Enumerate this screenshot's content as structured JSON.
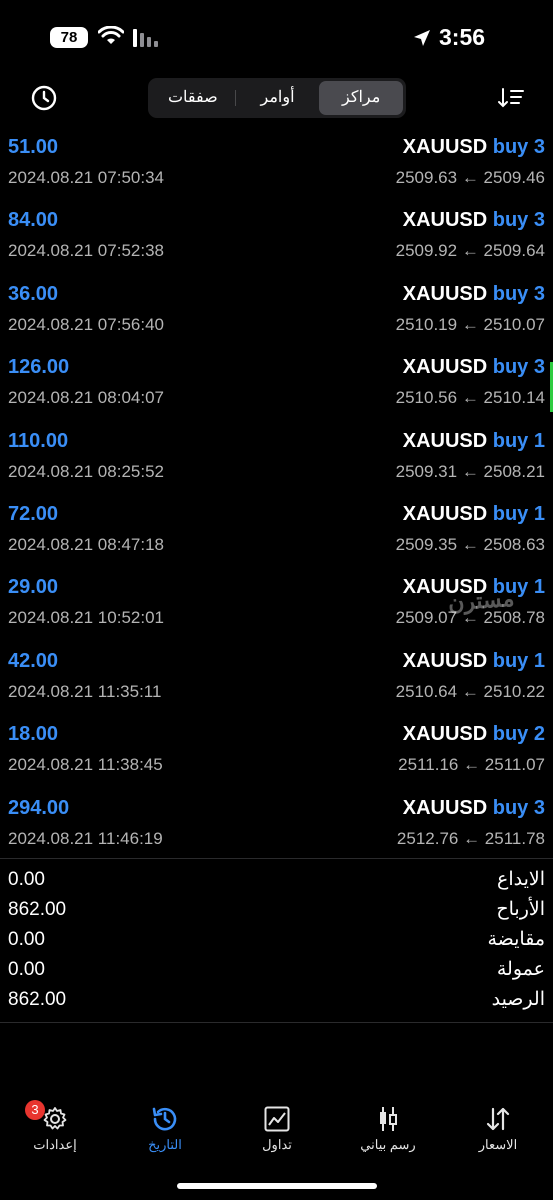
{
  "status_bar": {
    "battery": "78",
    "time": "3:56"
  },
  "header": {
    "tabs": [
      {
        "label": "مراكز",
        "active": true
      },
      {
        "label": "أوامر",
        "active": false
      },
      {
        "label": "صفقات",
        "active": false
      }
    ]
  },
  "deals": [
    {
      "symbol": "XAUUSD",
      "side": "buy 3",
      "profit": "51.00",
      "time": "2024.08.21 07:50:34",
      "prices": "2509.63 ← 2509.46"
    },
    {
      "symbol": "XAUUSD",
      "side": "buy 3",
      "profit": "84.00",
      "time": "2024.08.21 07:52:38",
      "prices": "2509.92 ← 2509.64"
    },
    {
      "symbol": "XAUUSD",
      "side": "buy 3",
      "profit": "36.00",
      "time": "2024.08.21 07:56:40",
      "prices": "2510.19 ← 2510.07"
    },
    {
      "symbol": "XAUUSD",
      "side": "buy 3",
      "profit": "126.00",
      "time": "2024.08.21 08:04:07",
      "prices": "2510.56 ← 2510.14"
    },
    {
      "symbol": "XAUUSD",
      "side": "buy 1",
      "profit": "110.00",
      "time": "2024.08.21 08:25:52",
      "prices": "2509.31 ← 2508.21"
    },
    {
      "symbol": "XAUUSD",
      "side": "buy 1",
      "profit": "72.00",
      "time": "2024.08.21 08:47:18",
      "prices": "2509.35 ← 2508.63"
    },
    {
      "symbol": "XAUUSD",
      "side": "buy 1",
      "profit": "29.00",
      "time": "2024.08.21 10:52:01",
      "prices": "2509.07 ← 2508.78"
    },
    {
      "symbol": "XAUUSD",
      "side": "buy 1",
      "profit": "42.00",
      "time": "2024.08.21 11:35:11",
      "prices": "2510.64 ← 2510.22"
    },
    {
      "symbol": "XAUUSD",
      "side": "buy 2",
      "profit": "18.00",
      "time": "2024.08.21 11:38:45",
      "prices": "2511.16 ← 2511.07"
    },
    {
      "symbol": "XAUUSD",
      "side": "buy 3",
      "profit": "294.00",
      "time": "2024.08.21 11:46:19",
      "prices": "2512.76 ← 2511.78"
    }
  ],
  "summary": [
    {
      "label": "الايداع",
      "value": "0.00"
    },
    {
      "label": "الأرباح",
      "value": "862.00"
    },
    {
      "label": "مقايضة",
      "value": "0.00"
    },
    {
      "label": "عمولة",
      "value": "0.00"
    },
    {
      "label": "الرصيد",
      "value": "862.00"
    }
  ],
  "watermark": "مسترن",
  "tabbar": {
    "settings_badge": "3",
    "items": [
      {
        "label": "إعدادات",
        "icon": "gear-icon"
      },
      {
        "label": "التاريخ",
        "icon": "history-icon",
        "active": true
      },
      {
        "label": "تداول",
        "icon": "trade-chart-icon"
      },
      {
        "label": "رسم بياني",
        "icon": "candlestick-icon"
      },
      {
        "label": "الاسعار",
        "icon": "quotes-arrows-icon"
      }
    ]
  },
  "colors": {
    "accent": "#3a8ef6",
    "badge": "#e8352f",
    "marker": "#2ecc40"
  }
}
